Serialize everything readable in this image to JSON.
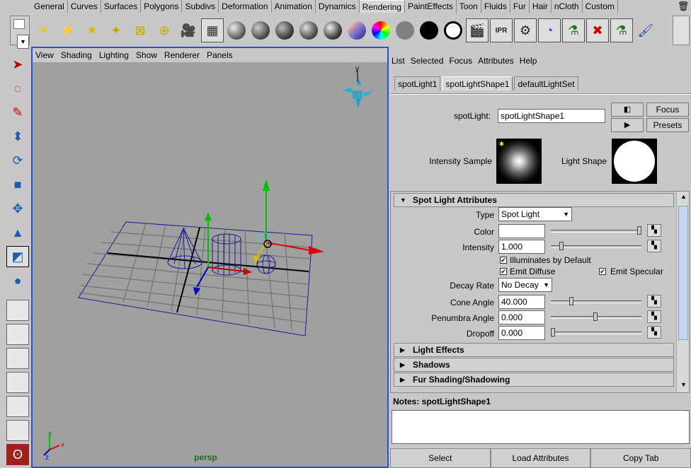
{
  "shelf_tabs": [
    {
      "label": "General"
    },
    {
      "label": "Curves"
    },
    {
      "label": "Surfaces"
    },
    {
      "label": "Polygons"
    },
    {
      "label": "Subdivs"
    },
    {
      "label": "Deformation"
    },
    {
      "label": "Animation"
    },
    {
      "label": "Dynamics"
    },
    {
      "label": "Rendering",
      "active": true
    },
    {
      "label": "PaintEffects"
    },
    {
      "label": "Toon"
    },
    {
      "label": "Fluids"
    },
    {
      "label": "Fur"
    },
    {
      "label": "Hair"
    },
    {
      "label": "nCloth"
    },
    {
      "label": "Custom"
    }
  ],
  "shelf_icons": [
    {
      "name": "ambient-light-icon",
      "glyph": "☀",
      "color": "#e8c800"
    },
    {
      "name": "directional-light-icon",
      "glyph": "⚡",
      "color": "#d8b800"
    },
    {
      "name": "point-light-icon",
      "glyph": "✷",
      "color": "#d8b800"
    },
    {
      "name": "spot-light-icon",
      "glyph": "✦",
      "color": "#c8a800"
    },
    {
      "name": "area-light-icon",
      "glyph": "⊠",
      "color": "#c8a800"
    },
    {
      "name": "volume-light-icon",
      "glyph": "⊕",
      "color": "#c8a800"
    },
    {
      "name": "camera-icon",
      "glyph": "🎥",
      "color": "#333"
    },
    {
      "name": "hypershade-icon",
      "glyph": "▦",
      "color": "#333",
      "framed": true
    },
    {
      "name": "material-sphere-1-icon",
      "sphere": "radial-gradient(circle at 35% 35%,#eee,#666 60%,#222)"
    },
    {
      "name": "material-sphere-2-icon",
      "sphere": "radial-gradient(circle at 35% 35%,#ccc,#555 60%,#111)"
    },
    {
      "name": "material-sphere-3-icon",
      "sphere": "radial-gradient(circle at 35% 35%,#bbb,#444 60%,#111)"
    },
    {
      "name": "material-sphere-4-icon",
      "sphere": "radial-gradient(circle at 35% 35%,#ddd,#555 60%,#111)"
    },
    {
      "name": "material-sphere-5-icon",
      "sphere": "radial-gradient(circle at 35% 35%,#eee,#444 60%,#000)"
    },
    {
      "name": "anisotropic-sphere-icon",
      "sphere": "linear-gradient(135deg,#ffe,#c9a 30%,#66c 60%,#226)"
    },
    {
      "name": "ramp-sphere-icon",
      "sphere": "conic-gradient(#f00,#ff0,#0f0,#0ff,#00f,#f0f,#f00)"
    },
    {
      "name": "gray-sphere-icon",
      "sphere": "#808080"
    },
    {
      "name": "black-sphere-icon",
      "sphere": "#000"
    },
    {
      "name": "white-circle-icon",
      "sphere": "#fff",
      "ring": true
    },
    {
      "name": "render-icon",
      "glyph": "🎬",
      "color": "#222",
      "framed": true
    },
    {
      "name": "ipr-render-icon",
      "glyph": "IPR",
      "color": "#222",
      "framed": true
    },
    {
      "name": "render-settings-icon",
      "glyph": "⚙",
      "color": "#222",
      "framed": true
    },
    {
      "name": "render-view-icon",
      "glyph": "◔",
      "color": "#1a5fb4",
      "framed": true
    },
    {
      "name": "batch-render-icon",
      "glyph": "⚗",
      "color": "#1a7a1a",
      "framed": true
    },
    {
      "name": "cancel-batch-render-icon",
      "glyph": "✖",
      "color": "#c00",
      "framed": true
    },
    {
      "name": "show-batch-render-icon",
      "glyph": "⚗",
      "color": "#1a7a1a",
      "framed": true
    },
    {
      "name": "paint-brush-icon",
      "glyph": "🖌",
      "color": "#2040c0"
    }
  ],
  "viewport": {
    "menu": [
      "View",
      "Shading",
      "Lighting",
      "Show",
      "Renderer",
      "Panels"
    ],
    "camera_label": "persp",
    "axis": {
      "y": "y",
      "z": "z",
      "x": "x"
    }
  },
  "attribute_editor": {
    "menu": [
      "List",
      "Selected",
      "Focus",
      "Attributes",
      "Help"
    ],
    "tabs": [
      {
        "label": "spotLight1"
      },
      {
        "label": "spotLightShape1",
        "active": true
      },
      {
        "label": "defaultLightSet"
      }
    ],
    "node_type_label": "spotLight:",
    "node_name": "spotLightShape1",
    "focus_button": "Focus",
    "presets_button": "Presets",
    "intensity_sample_label": "Intensity Sample",
    "light_shape_label": "Light Shape",
    "spot_section": "Spot Light Attributes",
    "type_label": "Type",
    "type_value": "Spot Light",
    "color_label": "Color",
    "color_value": "#ffffff",
    "intensity_label": "Intensity",
    "intensity_value": "1.000",
    "intensity_slider": 0.1,
    "illuminates_default_label": "Illuminates by Default",
    "illuminates_default": true,
    "emit_diffuse_label": "Emit Diffuse",
    "emit_diffuse": true,
    "emit_specular_label": "Emit Specular",
    "emit_specular": true,
    "decay_label": "Decay Rate",
    "decay_value": "No Decay",
    "cone_label": "Cone Angle",
    "cone_value": "40.000",
    "cone_slider": 0.22,
    "penumbra_label": "Penumbra Angle",
    "penumbra_value": "0.000",
    "penumbra_slider": 0.5,
    "dropoff_label": "Dropoff",
    "dropoff_value": "0.000",
    "dropoff_slider": 0.0,
    "sections": [
      "Light Effects",
      "Shadows",
      "Fur Shading/Shadowing"
    ],
    "notes_label": "Notes:  spotLightShape1",
    "bottom_buttons": [
      "Select",
      "Load Attributes",
      "Copy Tab"
    ]
  }
}
